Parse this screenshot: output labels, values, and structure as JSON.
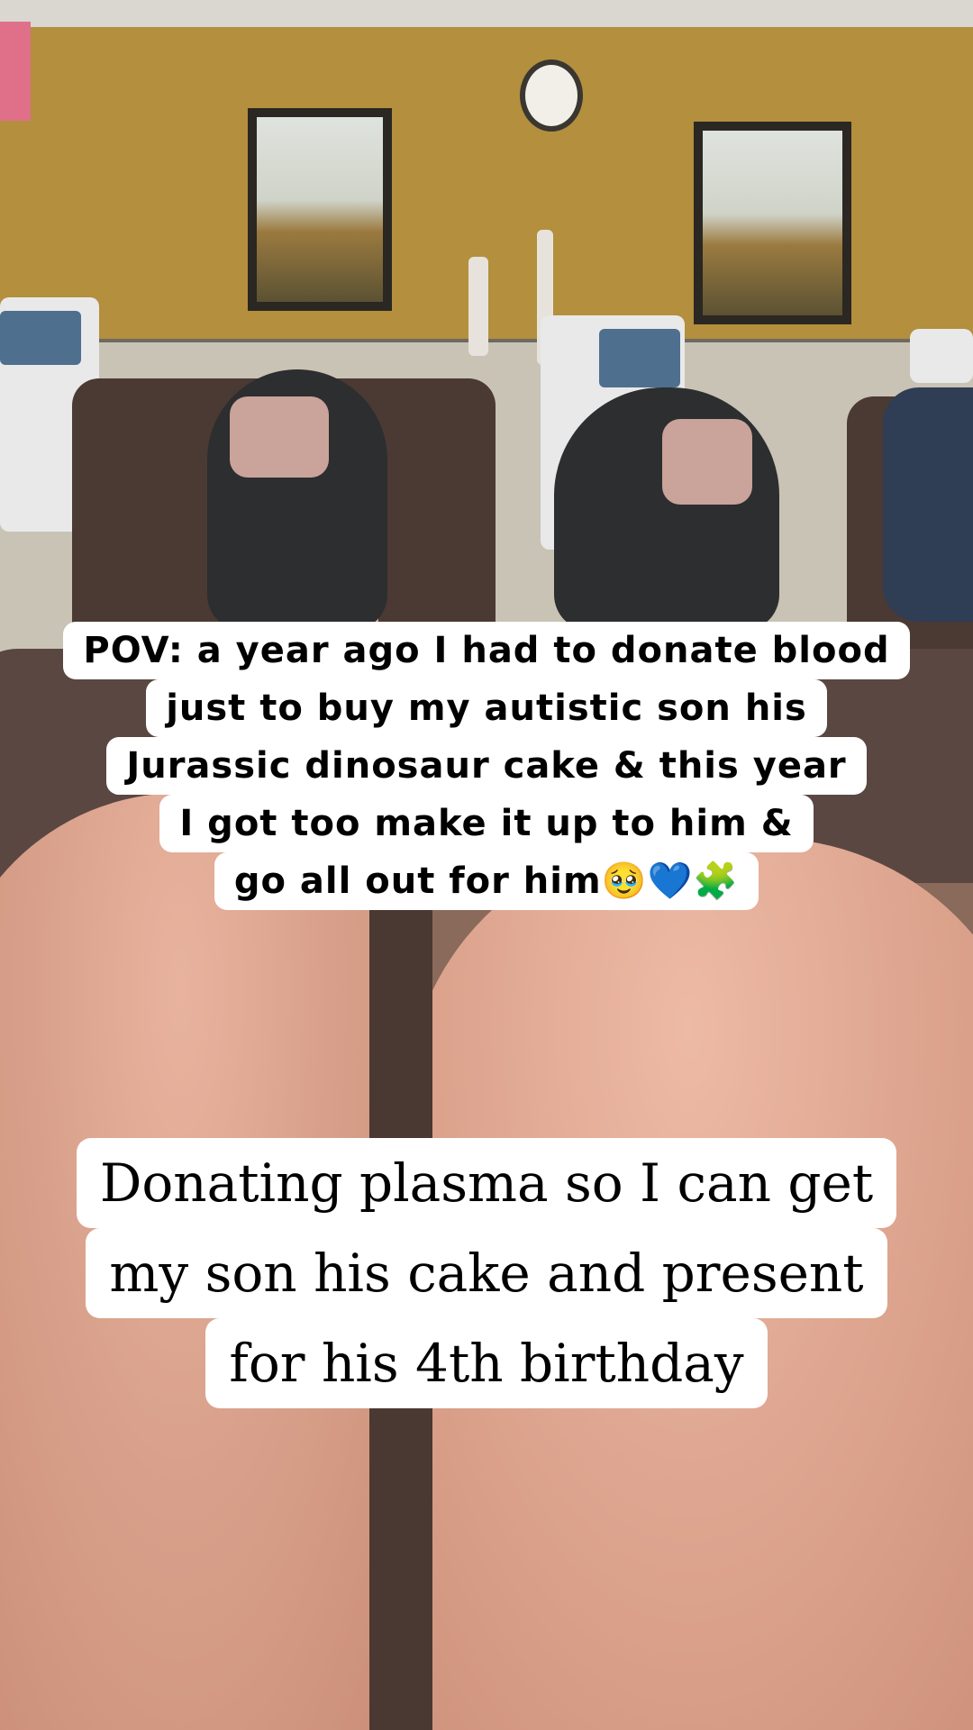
{
  "caption_top": {
    "lines": [
      "POV: a year ago I had to donate blood",
      "just to buy my autistic son his",
      "Jurassic dinosaur cake & this year",
      "I got too make it up to him &",
      "go all out for him🥹💙🧩"
    ]
  },
  "caption_bottom": {
    "lines": [
      "Donating plasma so I can get",
      "my son his cake and present",
      "for his 4th birthday"
    ]
  },
  "colors": {
    "wall": "#b38f3e",
    "caption_bg": "#ffffff",
    "caption_text": "#000000"
  }
}
